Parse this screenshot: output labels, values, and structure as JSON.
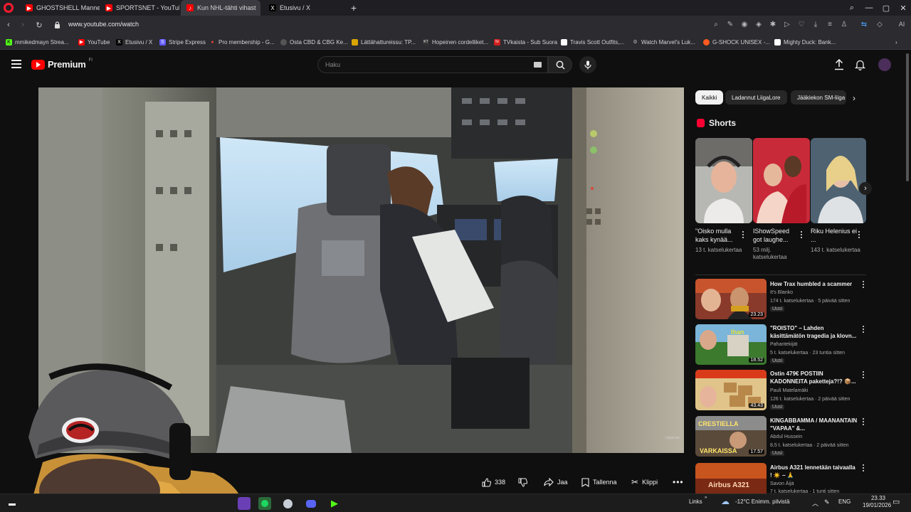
{
  "browser": {
    "tabs": [
      {
        "label": "GHOSTSHELL Mannequin",
        "color": "#ff0000"
      },
      {
        "label": "SPORTSNET - YouTube",
        "color": "#ff0000"
      },
      {
        "label": "Kun NHL-tähti vihast",
        "color": "#ff0000"
      },
      {
        "label": "Etusivu / X",
        "color": "#000000"
      }
    ],
    "url": "www.youtube.com/watch",
    "bookmarks": [
      {
        "label": "mmikedmayn Strea...",
        "color": "#53fc18"
      },
      {
        "label": "YouTube",
        "color": "#ff0000"
      },
      {
        "label": "Etusivu / X",
        "color": "#000000"
      },
      {
        "label": "Stripe Express",
        "color": "#635bff"
      },
      {
        "label": "Pro membership - G...",
        "color": "#ea4335"
      },
      {
        "label": "Osta CBD & CBG Ke...",
        "color": "#555555"
      },
      {
        "label": "Lättähattureissu: TP...",
        "color": "#d9a400"
      },
      {
        "label": "Hopeinen cordelliket...",
        "color": "#333333"
      },
      {
        "label": "TVkaista - Sub Suora",
        "color": "#d21f1f"
      },
      {
        "label": "Travis Scott Outfits,...",
        "color": "#ffffff"
      },
      {
        "label": "Watch Marvel's Luk...",
        "color": "#888888"
      },
      {
        "label": "G-SHOCK UNISEX -...",
        "color": "#ff5a1f"
      },
      {
        "label": "Mighty Duck: Bank...",
        "color": "#ffffff"
      }
    ]
  },
  "youtube": {
    "logo_text": "Premium",
    "logo_sup": "FI",
    "search_placeholder": "Haku",
    "video_watermark": "LiigaLore",
    "actions": {
      "likes": "338",
      "share": "Jaa",
      "save": "Tallenna",
      "clip": "Klippi"
    },
    "chips": [
      "Kaikki",
      "Ladannut LiigaLore",
      "Jääkiekon SM-liiga"
    ],
    "shorts_heading": "Shorts",
    "shorts": [
      {
        "title": "\"Oisko mulla kaks kynää...",
        "views": "13 t. katselukertaa"
      },
      {
        "title": "IShowSpeed got laughe...",
        "views": "53 milj. katselukertaa"
      },
      {
        "title": "Riku Helenius ei ...",
        "views": "143 t. katselukertaa"
      }
    ],
    "recommendations": [
      {
        "title": "How Trax humbled a scammer",
        "channel": "It's Blanko",
        "meta": "174 t. katselukertaa · 5 päivää sitten",
        "duration": "23.23",
        "badge": "Uusi"
      },
      {
        "title": "\"ROISTO\" – Lahden käsittämätön tragedia ja klovn...",
        "channel": "Pahantekijät",
        "meta": "5 t. katselukertaa · 23 tuntia sitten",
        "duration": "18.52",
        "badge": "Uusi"
      },
      {
        "title": "Ostin 479€ POSTIIN KADONNEITA paketteja?!? 📦...",
        "channel": "Pauli Matelamäki",
        "meta": "126 t. katselukertaa · 2 päivää sitten",
        "duration": "43.43",
        "badge": "Uusi"
      },
      {
        "title": "KINGABBAMMA / MAANANTAIN \"VAPAA\" &...",
        "channel": "Abdul Hussein",
        "meta": "8,5 t. katselukertaa · 2 päivää sitten",
        "duration": "17.57",
        "badge": "Uusi"
      },
      {
        "title": "Airbus A321 lennetään taivaalla ! ☀️ – 🙏",
        "channel": "Savon Äijä",
        "meta": "7 t. katselukertaa · 1 tunti sitten",
        "duration": "",
        "badge": ""
      }
    ]
  },
  "taskbar": {
    "links_label": "Links",
    "weather": "-12°C  Enimm. pilvistä",
    "lang": "ENG",
    "time": "23.33",
    "date": "19/01/2026"
  }
}
